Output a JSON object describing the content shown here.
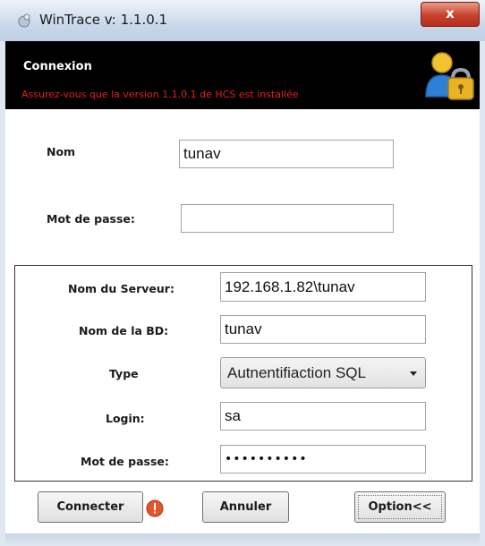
{
  "window": {
    "title": "WinTrace v: 1.1.0.1",
    "close_label": "x",
    "icon": "wintrace-app-icon"
  },
  "banner": {
    "heading": "Connexion",
    "warning": "Assurez-vous que la version 1.1.0.1 de HCS est installée",
    "warning_color": "#e4201c",
    "icon": "user-lock-icon"
  },
  "login": {
    "name_label": "Nom",
    "name_value": "tunav",
    "password_label": "Mot de passe:",
    "password_value": ""
  },
  "server": {
    "server_label": "Nom du Serveur:",
    "server_value": "192.168.1.82\\tunav",
    "db_label": "Nom de la BD:",
    "db_value": "tunav",
    "type_label": "Type",
    "type_value": "Autnentifiaction SQL",
    "login_label": "Login:",
    "login_value": "sa",
    "password_label": "Mot de passe:",
    "password_mask": "••••••••••"
  },
  "buttons": {
    "connect": "Connecter",
    "cancel": "Annuler",
    "options": "Option<<"
  },
  "colors": {
    "banner_bg": "#000000",
    "alert_icon": "#e2572b"
  }
}
